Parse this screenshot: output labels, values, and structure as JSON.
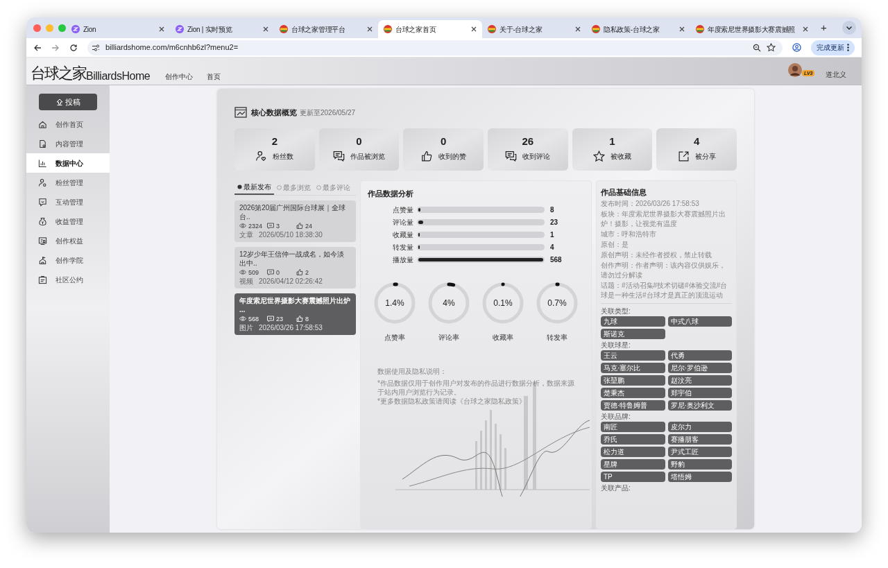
{
  "browser": {
    "tabs": [
      {
        "title": "Zion",
        "kind": "zion",
        "selected": false
      },
      {
        "title": "Zion | 实时预览",
        "kind": "zion",
        "selected": false
      },
      {
        "title": "台球之家管理平台",
        "kind": "site",
        "selected": false
      },
      {
        "title": "台球之家首页",
        "kind": "site",
        "selected": true
      },
      {
        "title": "关于-台球之家",
        "kind": "site",
        "selected": false
      },
      {
        "title": "隐私政策-台球之家",
        "kind": "site",
        "selected": false
      },
      {
        "title": "年度索尼世界摄影大赛震撼照",
        "kind": "site",
        "selected": false
      }
    ],
    "new_tab": "+",
    "url": "billiardshome.com/m6cnhb6zl?menu2=",
    "update_button": "完成更新"
  },
  "header": {
    "logo_mark": "台球之家",
    "logo_text": "BilliardsHome",
    "nav": [
      "创作中心",
      "首页"
    ],
    "user": {
      "level": "LV3",
      "name": "道北义"
    }
  },
  "sidebar": {
    "post_button": "投稿",
    "items": [
      {
        "label": "创作首页",
        "kind": "home",
        "selected": false
      },
      {
        "label": "内容管理",
        "kind": "content",
        "selected": false
      },
      {
        "label": "数据中心",
        "kind": "data",
        "selected": true
      },
      {
        "label": "粉丝管理",
        "kind": "fans",
        "selected": false
      },
      {
        "label": "互动管理",
        "kind": "interact",
        "selected": false
      },
      {
        "label": "收益管理",
        "kind": "income",
        "selected": false
      },
      {
        "label": "创作权益",
        "kind": "rights",
        "selected": false
      },
      {
        "label": "创作学院",
        "kind": "academy",
        "selected": false
      },
      {
        "label": "社区公约",
        "kind": "rules",
        "selected": false
      }
    ]
  },
  "overview": {
    "title": "核心数据概览",
    "updated": "更新至2026/05/27",
    "stats": [
      {
        "value": "2",
        "label": "粉丝数",
        "kind": "fans"
      },
      {
        "value": "0",
        "label": "作品被浏览",
        "kind": "views"
      },
      {
        "value": "0",
        "label": "收到的赞",
        "kind": "likes"
      },
      {
        "value": "26",
        "label": "收到评论",
        "kind": "comments"
      },
      {
        "value": "1",
        "label": "被收藏",
        "kind": "favorites"
      },
      {
        "value": "4",
        "label": "被分享",
        "kind": "shares"
      }
    ]
  },
  "works_tabs": [
    {
      "label": "最新发布",
      "selected": true
    },
    {
      "label": "最多浏览",
      "selected": false
    },
    {
      "label": "最多评论",
      "selected": false
    }
  ],
  "works": [
    {
      "title": "2026第20届广州国际台球展｜全球台..",
      "views": "2324",
      "comments": "3",
      "likes": "24",
      "type": "文章",
      "time": "2026/05/10 18:38:30",
      "selected": false
    },
    {
      "title": "12岁少年王信仲一战成名，如今淡出中..",
      "views": "509",
      "comments": "0",
      "likes": "2",
      "type": "视频",
      "time": "2026/04/12 02:26:42",
      "selected": false
    },
    {
      "title": "年度索尼世界摄影大赛震撼照片出炉 ...",
      "views": "568",
      "comments": "23",
      "likes": "8",
      "type": "图片",
      "time": "2026/03/26 17:58:53",
      "selected": true
    }
  ],
  "analysis": {
    "title": "作品数据分析",
    "metrics": [
      {
        "label": "点赞量",
        "level": 0.014,
        "value": "8"
      },
      {
        "label": "评论量",
        "level": 0.04,
        "value": "23"
      },
      {
        "label": "收藏量",
        "level": 0.002,
        "value": "1"
      },
      {
        "label": "转发量",
        "level": 0.007,
        "value": "4"
      },
      {
        "label": "播放量",
        "level": 1,
        "value": "568"
      }
    ],
    "rates": [
      {
        "value": "1.4%",
        "level": 0.014,
        "label": "点赞率"
      },
      {
        "value": "4%",
        "level": 0.04,
        "label": "评论率"
      },
      {
        "value": "0.1%",
        "level": 0.001,
        "label": "收藏率"
      },
      {
        "value": "0.7%",
        "level": 0.007,
        "label": "转发率"
      }
    ],
    "note_title": "数据使用及隐私说明：",
    "notes": [
      "*作品数据仅用于创作用户对发布的作品进行数据分析，数据来源于站内用户浏览行为记录。",
      "*更多数据隐私政策请阅读《台球之家隐私政策》"
    ]
  },
  "info": {
    "title": "作品基础信息",
    "fields": [
      "发布时间：2026/03/26 17:58:53",
      "板块：年度索尼世界摄影大赛震撼照片出炉！摄影，让视觉有温度",
      "城市：呼和浩特市",
      "原创：是",
      "原创声明：未经作者授权，禁止转载",
      "创作声明：作者声明：该内容仅供娱乐，请勿过分解读",
      "话题：#活动召集#技术切磋#体验交流#台球是一种生活#台球才是真正的顶流运动"
    ],
    "groups": [
      {
        "title": "关联类型:",
        "tags": [
          "九球",
          "中式八球",
          "斯诺克"
        ]
      },
      {
        "title": "关联球星:",
        "tags": [
          "王云",
          "代勇",
          "马克·塞尔比",
          "尼尔·罗伯逊",
          "张堃鹏",
          "赵汶亮",
          "楚秉杰",
          "郑宇伯",
          "贾德·特鲁姆普",
          "罗尼·奥沙利文"
        ]
      },
      {
        "title": "关联品牌:",
        "tags": [
          "南匠",
          "皮尔力",
          "乔氏",
          "赛播朋客",
          "松力道",
          "尹式工匠",
          "星牌",
          "野豹",
          "TP",
          "塔悟姆"
        ]
      },
      {
        "title": "关联产品:"
      }
    ]
  }
}
